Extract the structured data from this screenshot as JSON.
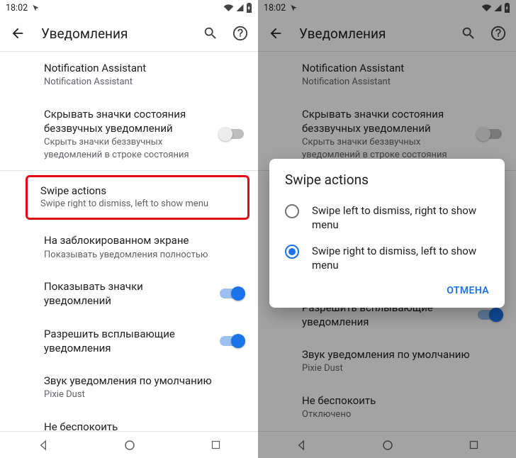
{
  "status": {
    "time": "18:02"
  },
  "header": {
    "title": "Уведомления"
  },
  "items": {
    "notif_assist": {
      "title": "Notification Assistant",
      "sub": "Notification Assistant"
    },
    "hide_silent": {
      "title": "Скрывать значки состояния беззвучных уведомлений",
      "sub": "Скрыть значки беззвучных уведомлений в строке состояния"
    },
    "swipe": {
      "title": "Swipe actions",
      "sub": "Swipe right to dismiss, left to show menu"
    },
    "lockscreen": {
      "title": "На заблокированном экране",
      "sub": "Показывать уведомления полностью"
    },
    "show_icons": {
      "title": "Показывать значки уведомлений"
    },
    "allow_popup": {
      "title": "Разрешить всплывающие уведомления"
    },
    "default_sound": {
      "title": "Звук уведомления по умолчанию",
      "sub": "Pixie Dust"
    },
    "dnd": {
      "title": "Не беспокоить",
      "sub": "Отключено"
    }
  },
  "dialog": {
    "title": "Swipe actions",
    "opt1": "Swipe left to dismiss, right to show menu",
    "opt2": "Swipe right to dismiss, left to show menu",
    "cancel": "ОТМЕНА"
  }
}
